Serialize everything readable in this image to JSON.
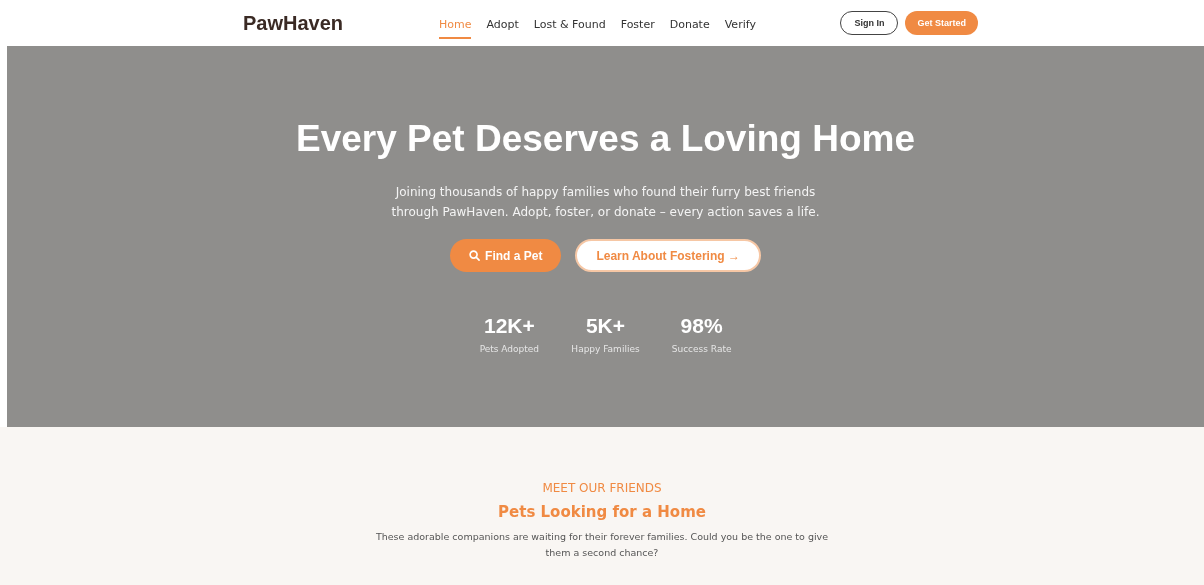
{
  "header": {
    "logo": "PawHaven",
    "nav": [
      {
        "label": "Home",
        "selected": true
      },
      {
        "label": "Adopt",
        "selected": false
      },
      {
        "label": "Lost & Found",
        "selected": false
      },
      {
        "label": "Foster",
        "selected": false
      },
      {
        "label": "Donate",
        "selected": false
      },
      {
        "label": "Verify",
        "selected": false
      }
    ],
    "sign_in": "Sign In",
    "get_started": "Get Started"
  },
  "hero": {
    "title": "Every Pet Deserves a Loving Home",
    "subtitle": "Joining thousands of happy families who found their furry best friends through PawHaven. Adopt, foster, or donate – every action saves a life.",
    "primary_button": "Find a Pet",
    "secondary_button": "Learn About Fostering →",
    "stats": [
      {
        "value": "12K+",
        "label": "Pets Adopted"
      },
      {
        "value": "5K+",
        "label": "Happy Families"
      },
      {
        "value": "98%",
        "label": "Success Rate"
      }
    ]
  },
  "section": {
    "eyebrow": "MEET OUR FRIENDS",
    "title": "Pets Looking for a Home",
    "description": "These adorable companions are waiting for their forever families. Could you be the one to give them a second chance?"
  }
}
